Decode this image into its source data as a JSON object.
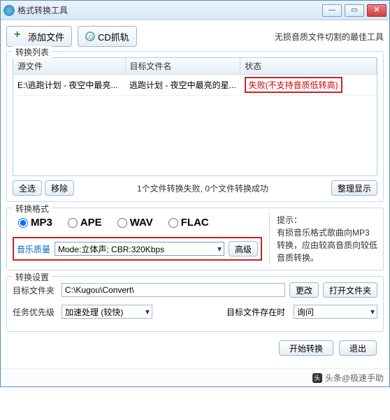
{
  "window": {
    "title": "格式转换工具"
  },
  "toolbar": {
    "add_file": "添加文件",
    "cd_rip": "CD抓轨",
    "right_text": "无损音质文件切割的最佳工具"
  },
  "list": {
    "legend": "转换列表",
    "cols": {
      "source": "源文件",
      "target": "目标文件名",
      "status": "状态"
    },
    "row": {
      "source": "E:\\逃跑计划 - 夜空中最亮...",
      "target": "逃跑计划 - 夜空中最亮的星...",
      "status": "失败(不支持音质低转高)"
    },
    "select_all": "全选",
    "remove": "移除",
    "summary": "1个文件转换失败, 0个文件转换成功",
    "tidy": "整理显示"
  },
  "format": {
    "legend": "转换格式",
    "options": {
      "mp3": "MP3",
      "ape": "APE",
      "wav": "WAV",
      "flac": "FLAC"
    },
    "quality_label": "音乐质量",
    "quality_value": "Mode:立体声; CBR:320Kbps",
    "advanced": "高级",
    "tip_head": "提示：",
    "tip_body": "有损音乐格式歌曲向MP3转换，应由较高音质向较低音质转换。"
  },
  "settings": {
    "legend": "转换设置",
    "target_folder_label": "目标文件夹",
    "target_folder_value": "C:\\Kugou\\Convert\\",
    "change": "更改",
    "open_folder": "打开文件夹",
    "priority_label": "任务优先级",
    "priority_value": "加速处理 (较快)",
    "exist_label": "目标文件存在时",
    "exist_value": "询问"
  },
  "bottom": {
    "start": "开始转换",
    "exit": "退出"
  },
  "footer": {
    "text": "头条@极速手助"
  }
}
